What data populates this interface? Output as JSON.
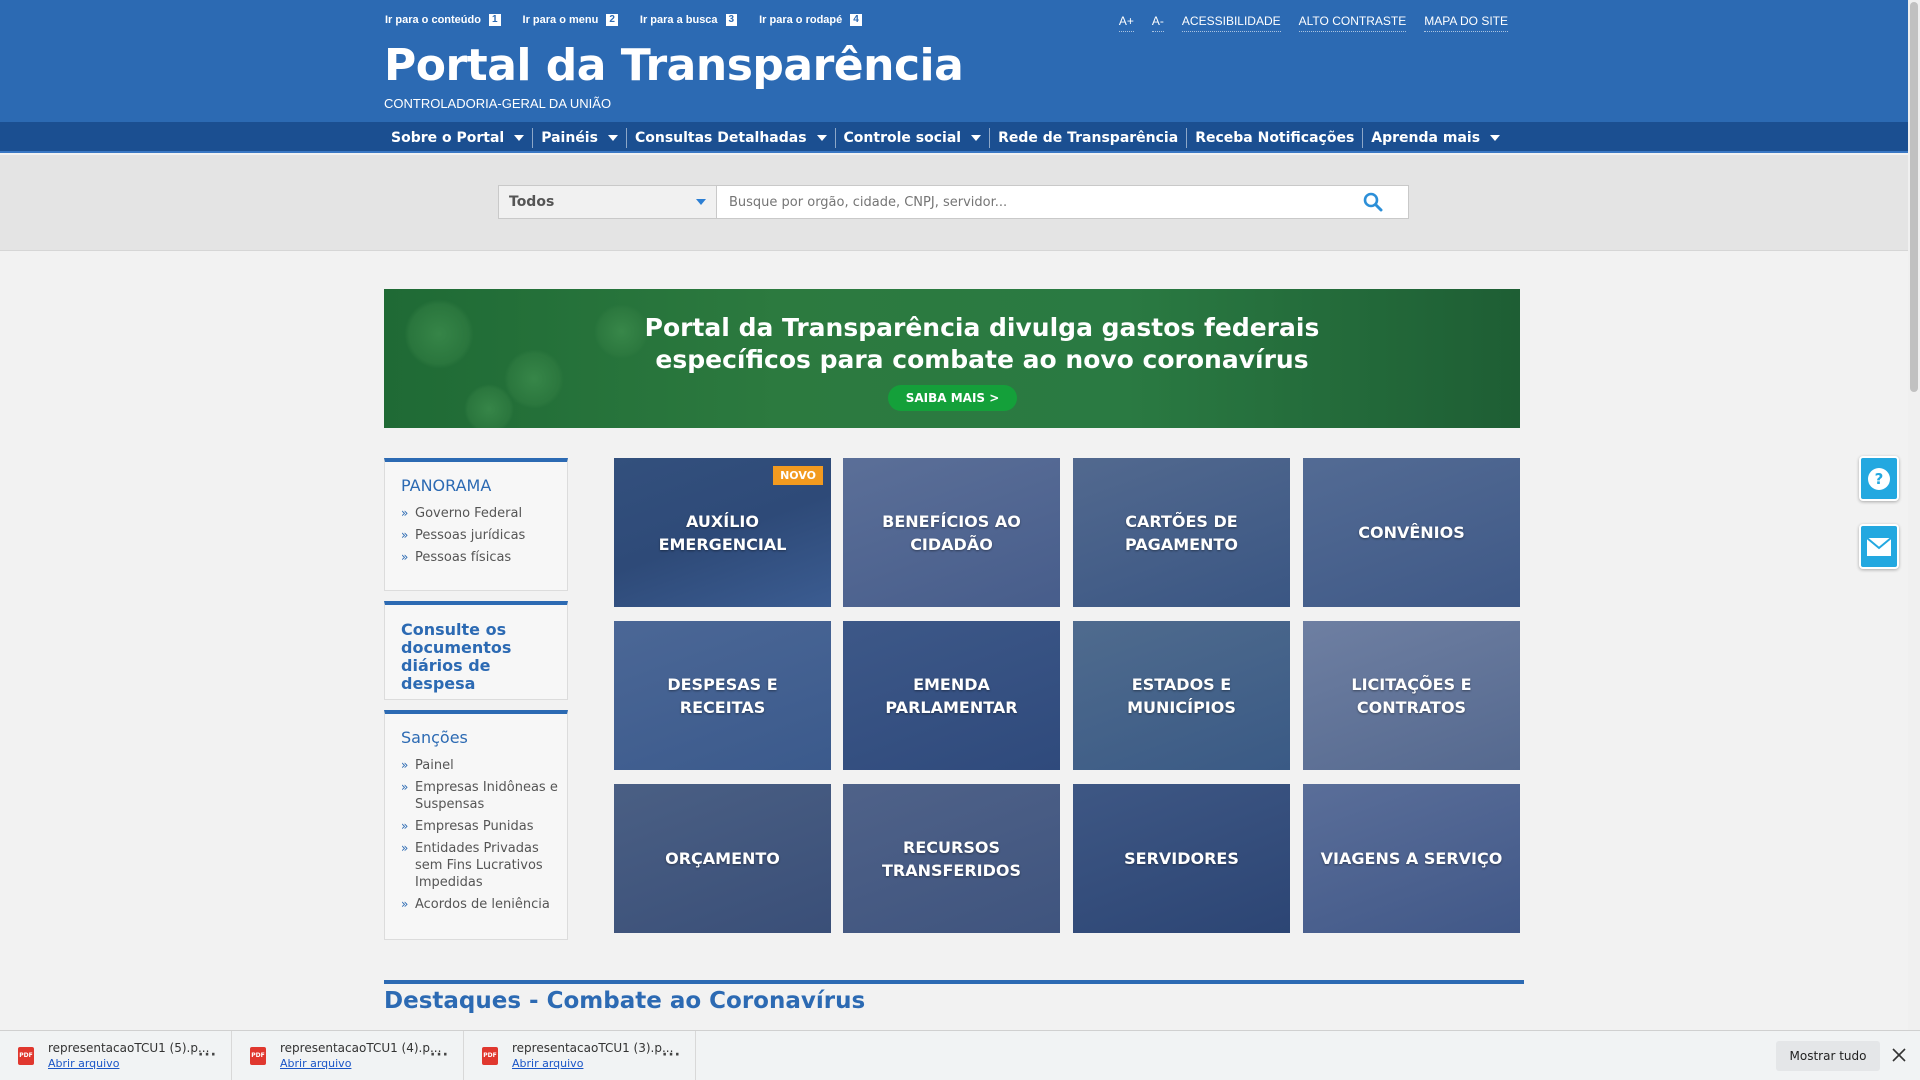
{
  "skiplinks": [
    {
      "label": "Ir para o conteúdo",
      "key": "1"
    },
    {
      "label": "Ir para o menu",
      "key": "2"
    },
    {
      "label": "Ir para a busca",
      "key": "3"
    },
    {
      "label": "Ir para o rodapé",
      "key": "4"
    }
  ],
  "toplinks": [
    "A+",
    "A-",
    "ACESSIBILIDADE",
    "ALTO CONTRASTE",
    "MAPA DO SITE"
  ],
  "brand": {
    "title": "Portal da Transparência",
    "subtitle": "CONTROLADORIA-GERAL DA UNIÃO"
  },
  "nav": [
    {
      "label": "Sobre o Portal",
      "dropdown": true
    },
    {
      "label": "Painéis",
      "dropdown": true
    },
    {
      "label": "Consultas Detalhadas",
      "dropdown": true
    },
    {
      "label": "Controle social",
      "dropdown": true
    },
    {
      "label": "Rede de Transparência",
      "dropdown": false
    },
    {
      "label": "Receba Notificações",
      "dropdown": false
    },
    {
      "label": "Aprenda mais",
      "dropdown": true
    }
  ],
  "search": {
    "scope": "Todos",
    "placeholder": "Busque por orgão, cidade, CNPJ, servidor..."
  },
  "banner": {
    "line1": "Portal da Transparência divulga gastos federais",
    "line2": "específicos para combate ao novo coronavírus",
    "cta": "SAIBA MAIS >"
  },
  "sidebar": {
    "panorama": {
      "title": "PANORAMA",
      "items": [
        "Governo Federal",
        "Pessoas jurídicas",
        "Pessoas físicas"
      ]
    },
    "documentos": {
      "title": "Consulte os documentos diários de despesa"
    },
    "sancoes": {
      "title": "Sanções",
      "items": [
        "Painel",
        "Empresas Inidôneas e Suspensas",
        "Empresas Punidas",
        "Entidades Privadas sem Fins Lucrativos Impedidas",
        "Acordos de leniência"
      ]
    }
  },
  "tiles": [
    {
      "label": "AUXÍLIO EMERGENCIAL",
      "badge": "NOVO"
    },
    {
      "label": "BENEFÍCIOS AO CIDADÃO"
    },
    {
      "label": "CARTÕES DE PAGAMENTO"
    },
    {
      "label": "CONVÊNIOS"
    },
    {
      "label": "DESPESAS E RECEITAS"
    },
    {
      "label": "EMENDA PARLAMENTAR"
    },
    {
      "label": "ESTADOS E MUNICÍPIOS"
    },
    {
      "label": "LICITAÇÕES E CONTRATOS"
    },
    {
      "label": "ORÇAMENTO"
    },
    {
      "label": "RECURSOS TRANSFERIDOS"
    },
    {
      "label": "SERVIDORES"
    },
    {
      "label": "VIAGENS A SERVIÇO"
    }
  ],
  "destaques": {
    "title": "Destaques - Combate ao Coronavírus"
  },
  "floating": {
    "help_icon": "question-icon",
    "mail_icon": "envelope-icon"
  },
  "downloads": {
    "items": [
      {
        "file": "representacaoTCU1 (5).p...",
        "action": "Abrir arquivo"
      },
      {
        "file": "representacaoTCU1 (4).p...",
        "action": "Abrir arquivo"
      },
      {
        "file": "representacaoTCU1 (3).p...",
        "action": "Abrir arquivo"
      }
    ],
    "show_all": "Mostrar tudo",
    "pdf_label": "PDF"
  },
  "colors": {
    "header": "#2c6ab3",
    "nav": "#1b4f91",
    "accent_green": "#14a03a",
    "badge": "#f29a1f",
    "float": "#23a8e0"
  }
}
